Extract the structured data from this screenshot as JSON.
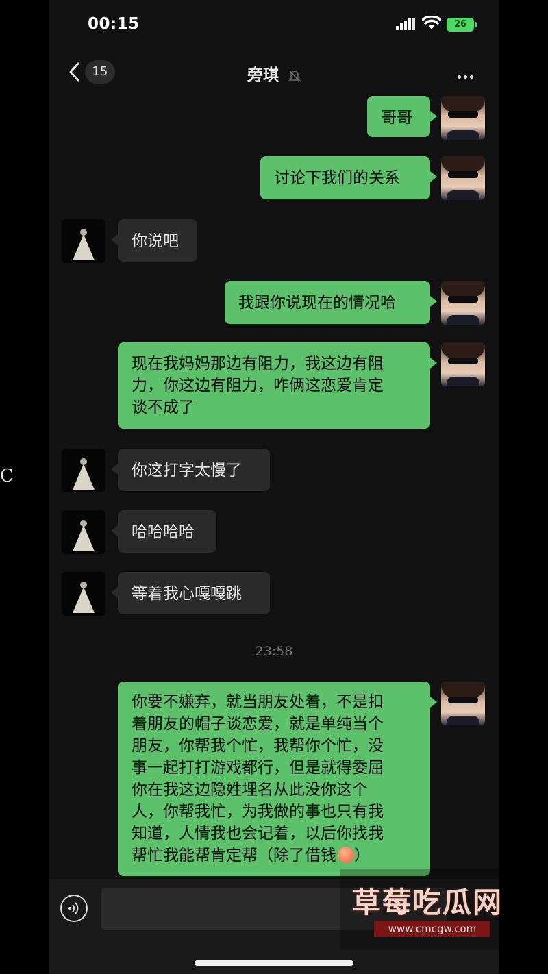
{
  "side_text": "C",
  "status_bar": {
    "time": "00:15",
    "battery": "26"
  },
  "nav": {
    "unread_count": "15",
    "title": "旁琪"
  },
  "messages": [
    {
      "from": "self",
      "text": "哥哥"
    },
    {
      "from": "self",
      "text": "讨论下我们的关系"
    },
    {
      "from": "other",
      "text": "你说吧"
    },
    {
      "from": "self",
      "text": "我跟你说现在的情况哈"
    },
    {
      "from": "self",
      "lines": [
        "现在我妈妈那边有阻力，我这边有阻",
        "力，你这边有阻力，咋俩这恋爱肯定",
        "谈不成了"
      ]
    },
    {
      "from": "other",
      "text": "你这打字太慢了"
    },
    {
      "from": "other",
      "text": "哈哈哈哈"
    },
    {
      "from": "other",
      "text": "等着我心嘎嘎跳"
    },
    {
      "from": "self",
      "lines": [
        "你要不嫌弃，就当朋友处着，不是扣",
        "着朋友的帽子谈恋爱，就是单纯当个",
        "朋友，你帮我个忙，我帮你个忙，没",
        "事一起打打游戏都行，但是就得委屈",
        "你在我这边隐姓埋名从此没你这个",
        "人，你帮我忙，为我做的事也只有我",
        "知道，人情我也会记着，以后你找我",
        "帮忙我能帮肯定帮（除了借钱",
        "）"
      ]
    }
  ],
  "time_separator": "23:58",
  "watermark": {
    "logo": "草莓吃瓜网",
    "url": "www.cmcgw.com"
  },
  "colors": {
    "bubble_self": "#5dc16b",
    "bubble_other": "#2a2a2a",
    "background": "#111111"
  },
  "icons": [
    "back-icon",
    "mute-icon",
    "more-icon",
    "voice-icon",
    "emoji-icon"
  ]
}
